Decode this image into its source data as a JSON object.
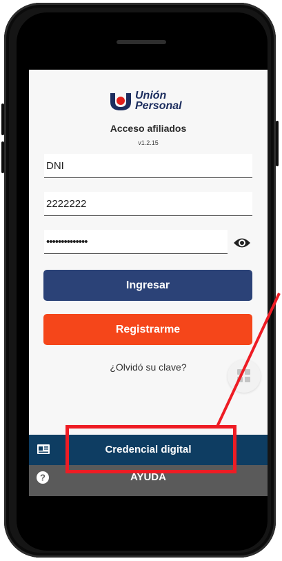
{
  "app": {
    "logo_line1": "Unión",
    "logo_line2": "Personal",
    "title": "Acceso afiliados",
    "version": "v1.2.15"
  },
  "form": {
    "doc_type_value": "DNI",
    "doc_number_value": "2222222",
    "password_value": "••••••••••••••"
  },
  "buttons": {
    "login_label": "Ingresar",
    "register_label": "Registrarme",
    "forgot_label": "¿Olvidó su clave?"
  },
  "bottom_bar": {
    "credential_label": "Credencial digital",
    "help_label": "AYUDA"
  },
  "icons": {
    "brand_logo": "union-personal-logo",
    "password_toggle": "eye-icon",
    "apps": "grid-icon",
    "credential": "id-card-icon",
    "help": "question-circle-icon"
  },
  "colors": {
    "login_button": "#2b4277",
    "register_button": "#f5461a",
    "credential_bar": "#0e3d62",
    "help_bar": "#5a5a5a",
    "annotation": "#ee1c24"
  }
}
